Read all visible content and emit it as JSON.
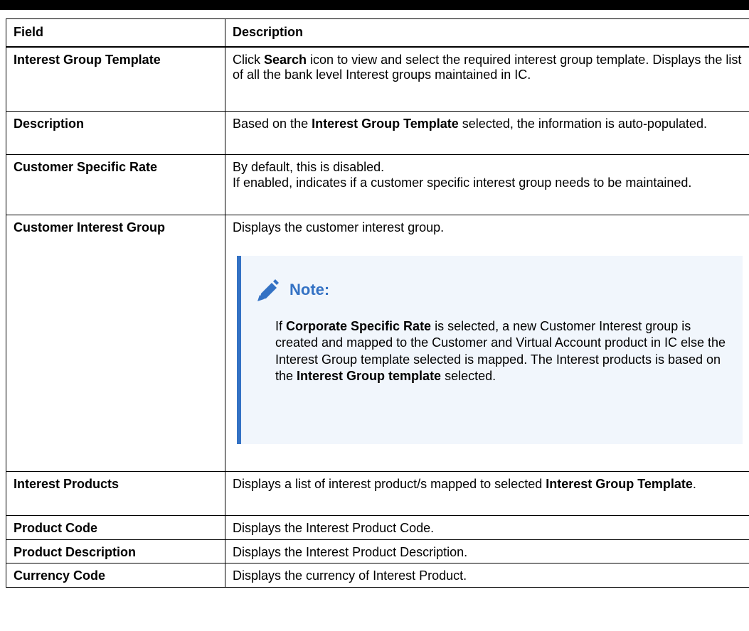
{
  "table": {
    "header": {
      "field": "Field",
      "description": "Description"
    },
    "rows": {
      "interest_group_template": {
        "field": "Interest Group Template",
        "d_pre": "Click ",
        "d_b1": "Search",
        "d_post": " icon to view and select the required interest group template. Displays the list of all the bank level Interest groups maintained in IC."
      },
      "description": {
        "field": "Description",
        "d_pre": "Based on the ",
        "d_b1": "Interest Group Template",
        "d_post": " selected, the information is auto-populated."
      },
      "customer_specific_rate": {
        "field": "Customer Specific Rate",
        "line1": "By default, this is disabled.",
        "line2": "If enabled, indicates if a customer specific interest group needs to be maintained."
      },
      "customer_interest_group": {
        "field": "Customer Interest Group",
        "description": "Displays the customer interest group.",
        "note": {
          "title": "Note:",
          "icon": "pencil-icon",
          "p_pre": "If ",
          "p_b1": "Corporate Specific Rate",
          "p_mid": " is selected, a new Customer Interest group is created and mapped to the Customer and Virtual Account product in IC else the Interest Group template selected is mapped. The Interest products is based on the ",
          "p_b2": "Interest Group template",
          "p_post": " selected."
        }
      },
      "interest_products": {
        "field": "Interest Products",
        "d_pre": "Displays a list of interest product/s mapped to selected ",
        "d_b1": "Interest Group Template",
        "d_post": "."
      },
      "product_code": {
        "field": "Product Code",
        "description": "Displays the Interest Product Code."
      },
      "product_description": {
        "field": "Product Description",
        "description": "Displays the Interest Product Description."
      },
      "currency_code": {
        "field": "Currency Code",
        "description": "Displays the currency of Interest Product."
      }
    }
  },
  "colors": {
    "note_accent": "#3472c4",
    "note_background": "#f1f6fc"
  }
}
